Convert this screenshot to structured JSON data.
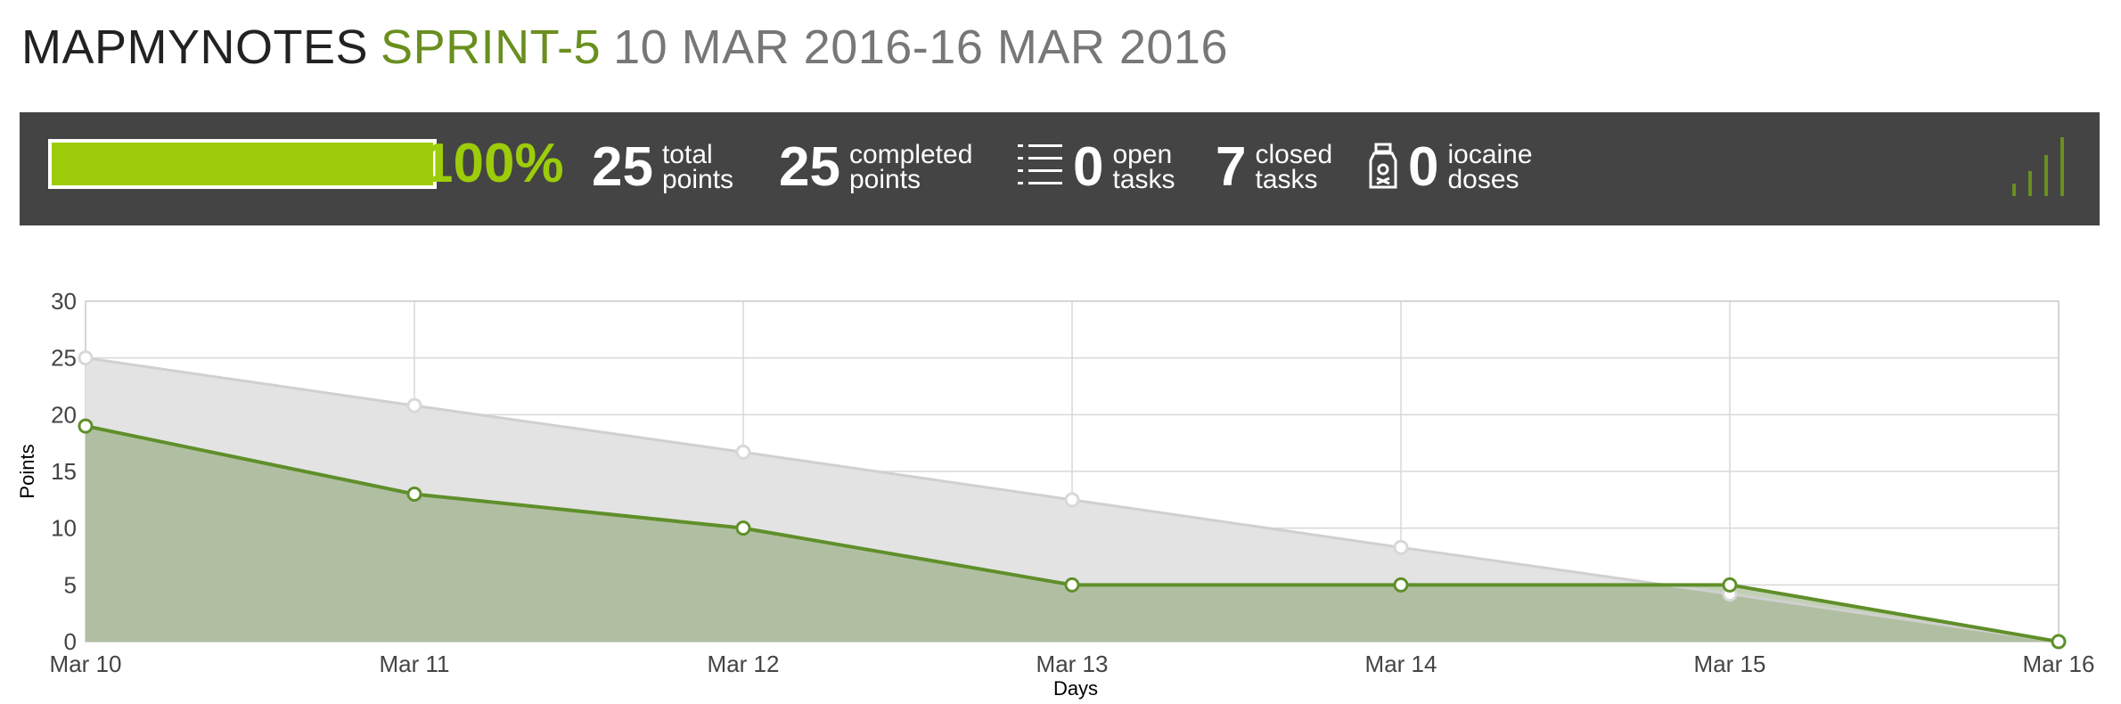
{
  "header": {
    "project": "MAPMYNOTES",
    "sprint": "SPRINT-5",
    "dates": "10 MAR 2016-16 MAR 2016"
  },
  "summary": {
    "progress_percent": 100,
    "progress_label": "100%",
    "total_points": {
      "value": "25",
      "label1": "total",
      "label2": "points"
    },
    "completed_points": {
      "value": "25",
      "label1": "completed",
      "label2": "points"
    },
    "open_tasks": {
      "value": "0",
      "label1": "open",
      "label2": "tasks",
      "icon": "task-list-icon"
    },
    "closed_tasks": {
      "value": "7",
      "label1": "closed",
      "label2": "tasks"
    },
    "iocaine": {
      "value": "0",
      "label1": "iocaine",
      "label2": "doses",
      "icon": "iocaine-bottle-icon"
    },
    "signal_icon": "signal-bars-icon",
    "colors": {
      "bar_bg": "#444444",
      "accent": "#9ccc0a",
      "sprint": "#6a8f1f"
    }
  },
  "chart_data": {
    "type": "area",
    "xlabel": "Days",
    "ylabel": "Points",
    "x": [
      "Mar 10",
      "Mar 11",
      "Mar 12",
      "Mar 13",
      "Mar 14",
      "Mar 15",
      "Mar 16"
    ],
    "yticks": [
      "0",
      "5",
      "10",
      "15",
      "20",
      "25",
      "30"
    ],
    "ylim": [
      0,
      30
    ],
    "grid": true,
    "series": [
      {
        "name": "",
        "values": [
          25,
          20.8,
          16.7,
          12.5,
          8.3,
          4.2,
          0
        ],
        "color": "#d0d0d0"
      },
      {
        "name": "",
        "values": [
          19,
          13,
          10,
          5,
          5,
          5,
          0
        ],
        "color": "#5f8f2a"
      }
    ]
  }
}
